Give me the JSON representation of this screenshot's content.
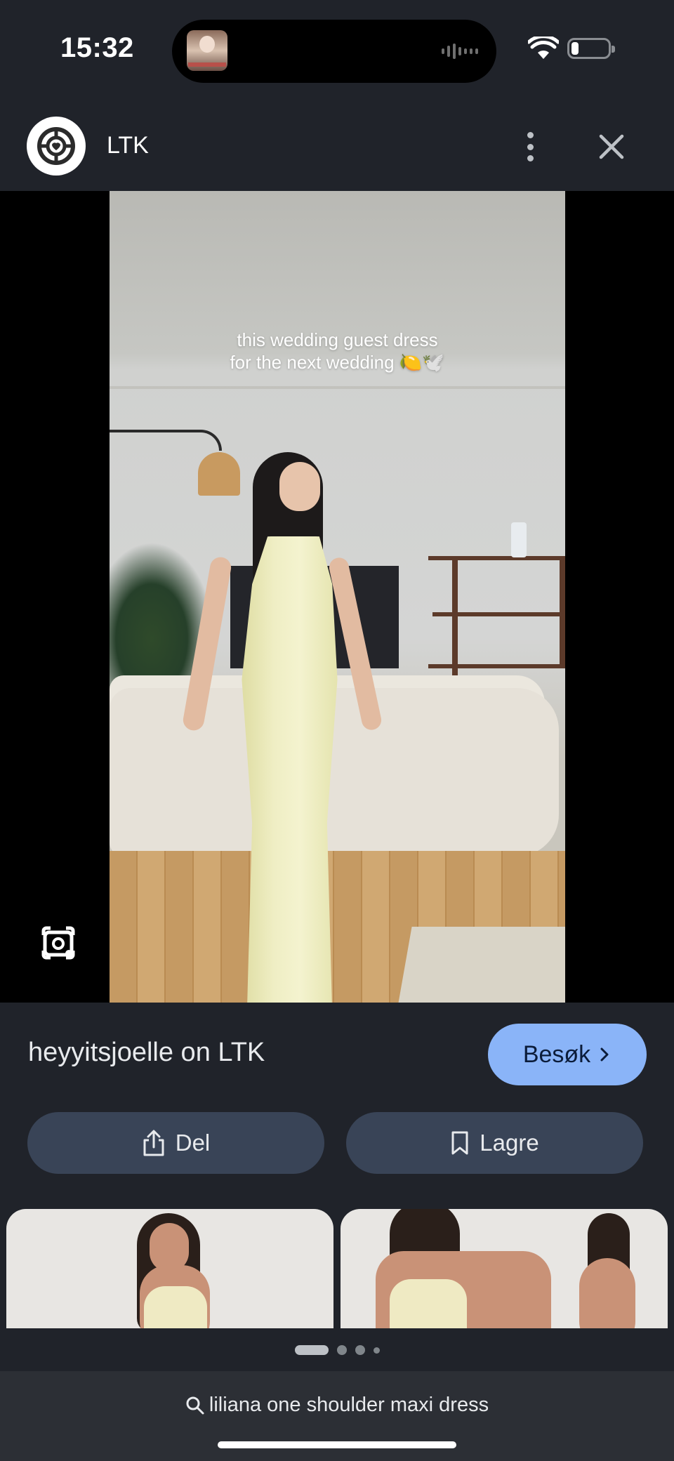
{
  "status_bar": {
    "time": "15:32"
  },
  "header": {
    "app_name": "LTK"
  },
  "media": {
    "caption_line1": "this wedding guest dress",
    "caption_line2": "for the next wedding 🍋🕊️"
  },
  "info": {
    "source_title": "heyyitsjoelle on LTK",
    "visit_label": "Besøk",
    "share_label": "Del",
    "save_label": "Lagre"
  },
  "pager": {
    "pages": 4,
    "active_index": 0
  },
  "search": {
    "query": "liliana one shoulder maxi dress"
  },
  "icons": {
    "logo": "ltk-logo-icon",
    "more": "more-vert-icon",
    "close": "close-icon",
    "lens": "lens-search-icon",
    "visit": "chevron-right-icon",
    "share": "share-icon",
    "save": "bookmark-icon",
    "search": "search-icon"
  },
  "colors": {
    "accent": "#8ab4f8",
    "button_bg": "#394457",
    "background": "#20232a"
  }
}
